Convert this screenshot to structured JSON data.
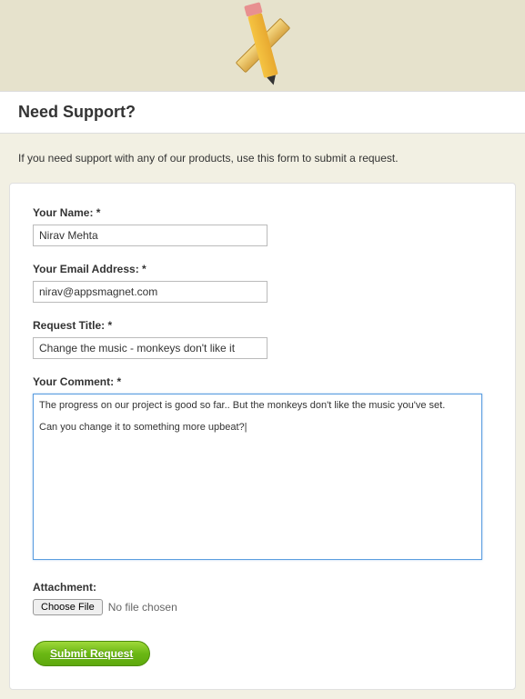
{
  "header": {
    "title": "Need Support?"
  },
  "intro": "If you need support with any of our products, use this form to submit a request.",
  "form": {
    "name": {
      "label": "Your Name: *",
      "value": "Nirav Mehta"
    },
    "email": {
      "label": "Your Email Address: *",
      "value": "nirav@appsmagnet.com"
    },
    "title": {
      "label": "Request Title: *",
      "value": "Change the music - monkeys don't like it"
    },
    "comment": {
      "label": "Your Comment: *",
      "value": "The progress on our project is good so far.. But the monkeys don't like the music you've set.\n\nCan you change it to something more upbeat?|"
    },
    "attachment": {
      "label": "Attachment:",
      "button": "Choose File",
      "status": "No file chosen"
    },
    "submit": "Submit Request"
  }
}
